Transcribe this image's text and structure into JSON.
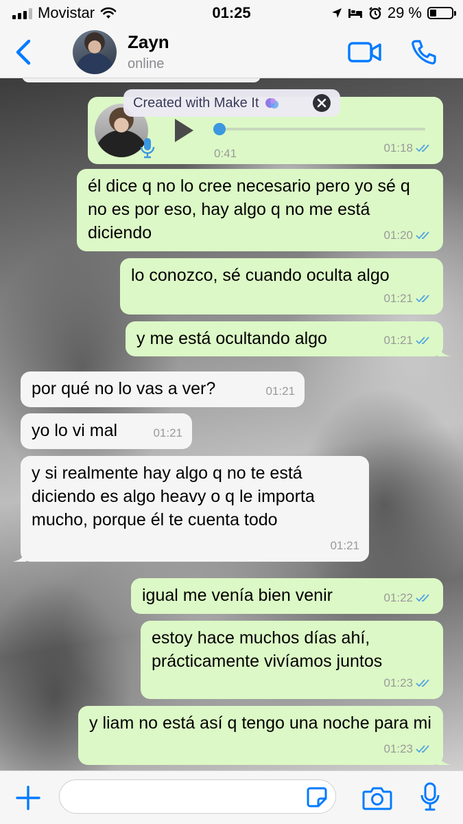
{
  "status_bar": {
    "carrier": "Movistar",
    "time": "01:25",
    "battery_percent": "29 %",
    "battery_level": 0.29
  },
  "header": {
    "contact_name": "Zayn",
    "contact_status": "online"
  },
  "watermark": {
    "text": "Created with Make It"
  },
  "voice_note": {
    "duration": "0:41",
    "time": "01:18",
    "progress": 0
  },
  "messages": [
    {
      "direction": "out",
      "text": "él dice q no lo cree necesario pero yo sé q no es por eso, hay algo q no me está diciendo",
      "time": "01:20"
    },
    {
      "direction": "out",
      "text": "lo conozco, sé cuando oculta algo",
      "time": "01:21"
    },
    {
      "direction": "out",
      "text": "y me está ocultando algo",
      "time": "01:21"
    },
    {
      "direction": "in",
      "text": "por qué no lo vas a ver?",
      "time": "01:21"
    },
    {
      "direction": "in",
      "text": "yo lo vi mal",
      "time": "01:21"
    },
    {
      "direction": "in",
      "text": "y si realmente hay algo q no te está diciendo es algo heavy o q le importa mucho, porque él te cuenta todo",
      "time": "01:21"
    },
    {
      "direction": "out",
      "text": "igual me venía bien venir",
      "time": "01:22"
    },
    {
      "direction": "out",
      "text": "estoy hace muchos días ahí, prácticamente vivíamos juntos",
      "time": "01:23"
    },
    {
      "direction": "out",
      "text": "y liam no está así q tengo una noche para mi",
      "time": "01:23"
    }
  ],
  "input": {
    "value": "",
    "placeholder": ""
  },
  "colors": {
    "accent": "#007aff",
    "outgoing_bubble": "#dcf8c6",
    "incoming_bubble": "#f5f5f5",
    "read_ticks": "#4fa3e0",
    "voice_knob": "#3b97e0"
  },
  "icons": {
    "back": "chevron-left-icon",
    "video": "video-camera-icon",
    "call": "phone-icon",
    "play": "play-icon",
    "mic": "microphone-icon",
    "plus": "plus-icon",
    "sticker": "sticker-icon",
    "camera": "camera-icon",
    "read_receipt": "double-check-icon"
  }
}
